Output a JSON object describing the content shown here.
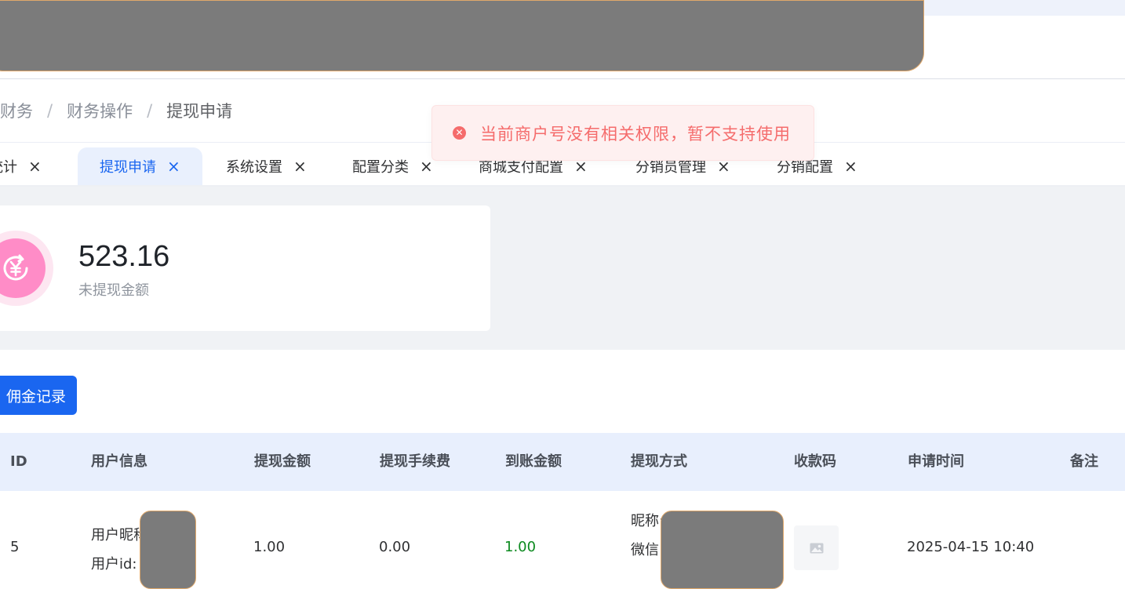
{
  "breadcrumb": {
    "items": [
      "财务",
      "财务操作",
      "提现申请"
    ],
    "separator": "/"
  },
  "tabs": [
    {
      "label": "统计",
      "active": false
    },
    {
      "label": "提现申请",
      "active": true
    },
    {
      "label": "系统设置",
      "active": false
    },
    {
      "label": "配置分类",
      "active": false
    },
    {
      "label": "商城支付配置",
      "active": false
    },
    {
      "label": "分销员管理",
      "active": false
    },
    {
      "label": "分销配置",
      "active": false
    }
  ],
  "tab_close_glyph": "×",
  "toast": {
    "type": "error",
    "icon": "error-circle-icon",
    "message": "当前商户号没有相关权限，暂不支持使用"
  },
  "stat": {
    "value": "523.16",
    "label": "未提现金额",
    "icon": "yen-refresh-icon"
  },
  "buttons": {
    "record_label": "佣金记录"
  },
  "table": {
    "headers": [
      "ID",
      "用户信息",
      "提现金额",
      "提现手续费",
      "到账金额",
      "提现方式",
      "收款码",
      "申请时间",
      "备注"
    ],
    "rows": [
      {
        "id": "5",
        "user_name_label": "用户昵称",
        "user_id_label": "用户id:",
        "amount": "1.00",
        "fee": "0.00",
        "received": "1.00",
        "method_line1": "昵称:",
        "method_line2": "微信",
        "qr_icon": "image-placeholder-icon",
        "time": "2025-04-15 10:40",
        "remark": ""
      }
    ]
  },
  "colors": {
    "primary": "#1a66f0",
    "error": "#f56c6c",
    "success_amount": "#0c8a1f",
    "stat_icon": "#ff8cc7"
  }
}
